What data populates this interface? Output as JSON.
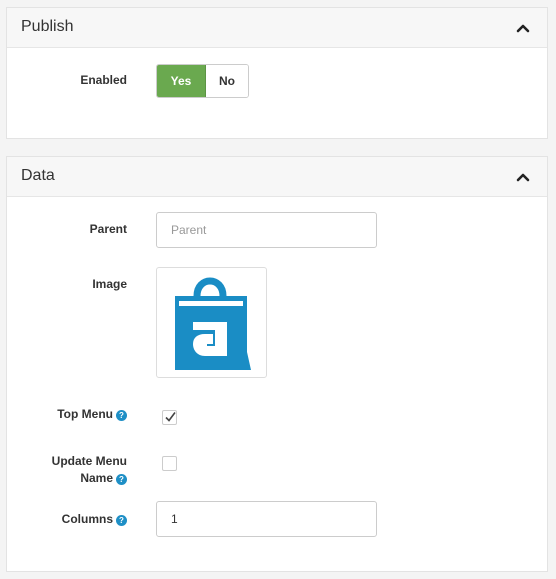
{
  "publish": {
    "title": "Publish",
    "enabled_label": "Enabled",
    "yes_label": "Yes",
    "no_label": "No",
    "enabled": true
  },
  "data": {
    "title": "Data",
    "parent_label": "Parent",
    "parent_placeholder": "Parent",
    "image_label": "Image",
    "top_menu_label": "Top Menu",
    "top_menu_checked": true,
    "update_menu_name_line1": "Update Menu",
    "update_menu_name_line2": "Name",
    "update_menu_name_checked": false,
    "columns_label": "Columns",
    "columns_value": "1",
    "help_glyph": "?",
    "brand_color": "#1a8dc5"
  }
}
